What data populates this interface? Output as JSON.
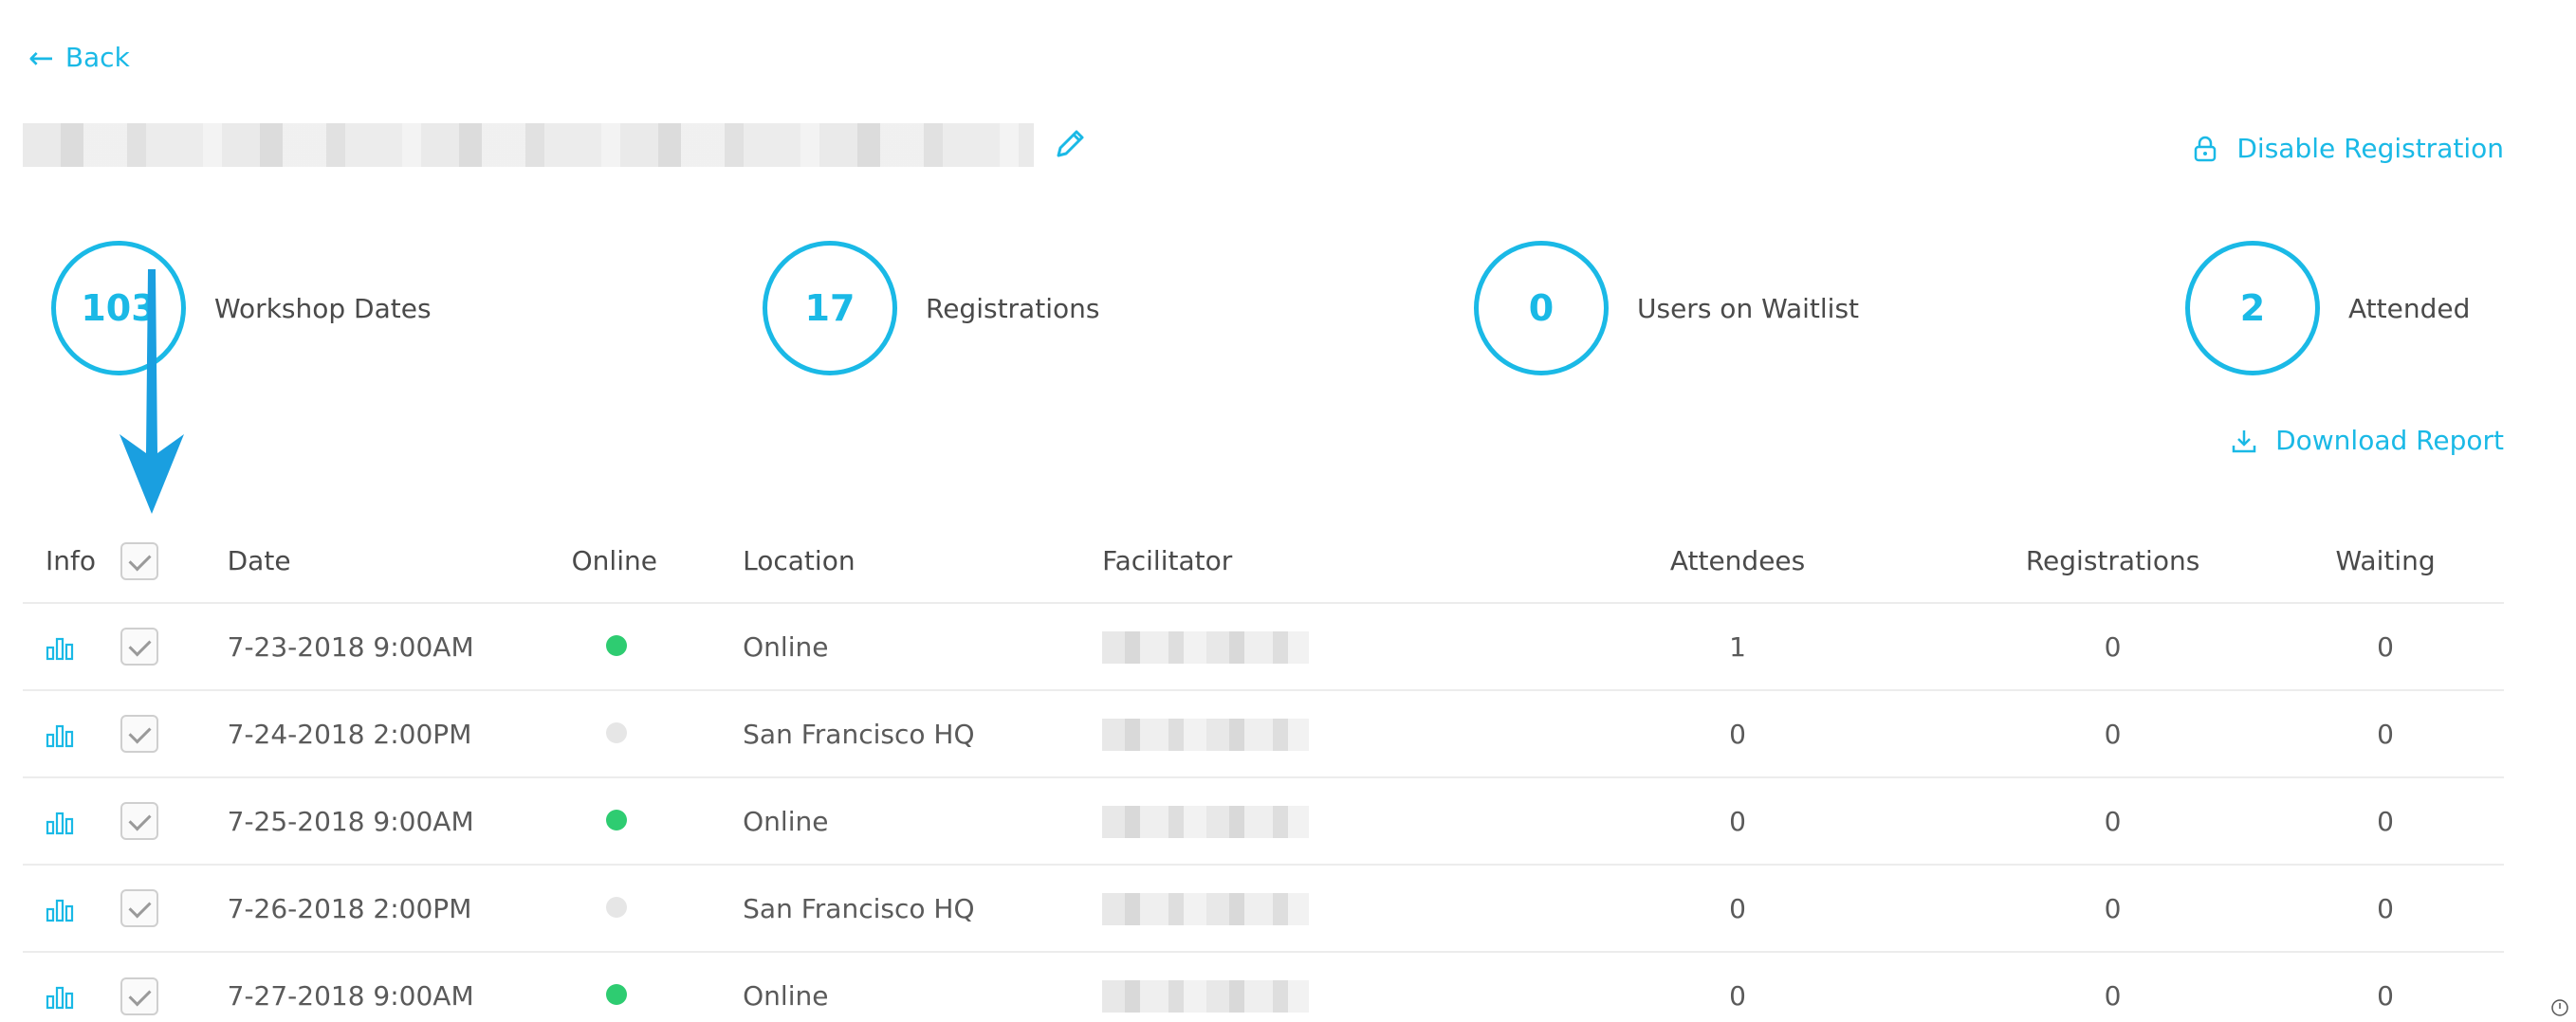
{
  "nav": {
    "back_label": "Back"
  },
  "header": {
    "disable_registration_label": "Disable Registration"
  },
  "stats": [
    {
      "value": "103",
      "label": "Workshop Dates"
    },
    {
      "value": "17",
      "label": "Registrations"
    },
    {
      "value": "0",
      "label": "Users on Waitlist"
    },
    {
      "value": "2",
      "label": "Attended"
    }
  ],
  "download_report_label": "Download Report",
  "table": {
    "headers": {
      "info": "Info",
      "date": "Date",
      "online": "Online",
      "location": "Location",
      "facilitator": "Facilitator",
      "attendees": "Attendees",
      "registrations": "Registrations",
      "waiting": "Waiting"
    },
    "rows": [
      {
        "date": "7-23-2018 9:00AM",
        "online": true,
        "location": "Online",
        "attendees": "1",
        "registrations": "0",
        "waiting": "0"
      },
      {
        "date": "7-24-2018 2:00PM",
        "online": false,
        "location": "San Francisco HQ",
        "attendees": "0",
        "registrations": "0",
        "waiting": "0"
      },
      {
        "date": "7-25-2018 9:00AM",
        "online": true,
        "location": "Online",
        "attendees": "0",
        "registrations": "0",
        "waiting": "0"
      },
      {
        "date": "7-26-2018 2:00PM",
        "online": false,
        "location": "San Francisco HQ",
        "attendees": "0",
        "registrations": "0",
        "waiting": "0"
      },
      {
        "date": "7-27-2018 9:00AM",
        "online": true,
        "location": "Online",
        "attendees": "0",
        "registrations": "0",
        "waiting": "0"
      }
    ]
  },
  "colors": {
    "accent": "#1ab9e6",
    "online_on": "#2ecc71",
    "online_off": "#e6e6e6"
  },
  "icons": {
    "back": "arrow-left-icon",
    "edit": "pencil-icon",
    "disable_registration": "lock-icon",
    "download": "download-icon",
    "row_info": "bar-chart-icon",
    "annotation": "callout-arrow-icon"
  }
}
